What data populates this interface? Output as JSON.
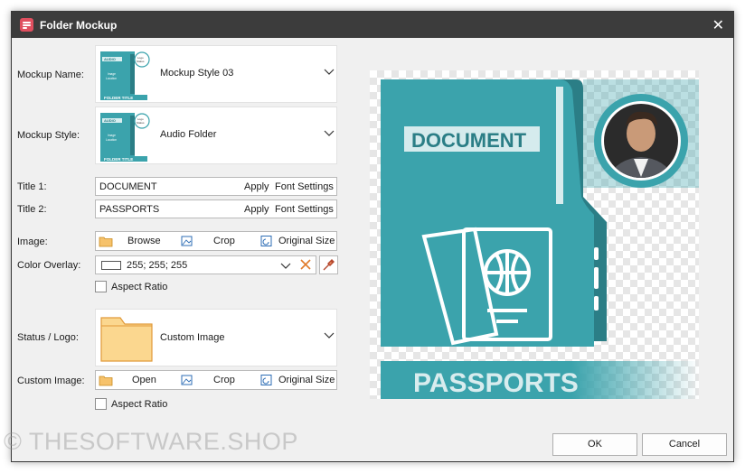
{
  "window": {
    "title": "Folder Mockup",
    "close_glyph": "✕"
  },
  "form": {
    "mockup_name": {
      "label": "Mockup Name:",
      "value": "Mockup Style 03",
      "thumb": {
        "tag": "AUDIO",
        "image_text": "Image Location",
        "logo_text": "Logo Status",
        "footer": "FOLDER TITLE"
      }
    },
    "mockup_style": {
      "label": "Mockup Style:",
      "value": "Audio Folder",
      "thumb": {
        "tag": "AUDIO",
        "image_text": "Image Location",
        "logo_text": "Logo Status",
        "footer": "FOLDER TITLE"
      }
    },
    "title1": {
      "label": "Title 1:",
      "value": "DOCUMENT",
      "apply": "Apply",
      "font_settings": "Font Settings"
    },
    "title2": {
      "label": "Title 2:",
      "value": "PASSPORTS",
      "apply": "Apply",
      "font_settings": "Font Settings"
    },
    "image": {
      "label": "Image:",
      "browse": "Browse",
      "crop": "Crop",
      "original_size": "Original Size"
    },
    "color_overlay": {
      "label": "Color Overlay:",
      "value": "255; 255; 255",
      "swatch_color": "#ffffff"
    },
    "aspect_ratio_1": {
      "label": "Aspect Ratio",
      "checked": false
    },
    "status_logo": {
      "label": "Status / Logo:",
      "value": "Custom Image"
    },
    "custom_image": {
      "label": "Custom Image:",
      "open": "Open",
      "crop": "Crop",
      "original_size": "Original Size"
    },
    "aspect_ratio_2": {
      "label": "Aspect Ratio",
      "checked": false
    }
  },
  "preview": {
    "title1": "DOCUMENT",
    "title2": "PASSPORTS",
    "accent": "#3ba3ac",
    "accent_dark": "#2b7e86"
  },
  "buttons": {
    "ok": "OK",
    "cancel": "Cancel"
  },
  "watermark": "© THESOFTWARE.SHOP"
}
